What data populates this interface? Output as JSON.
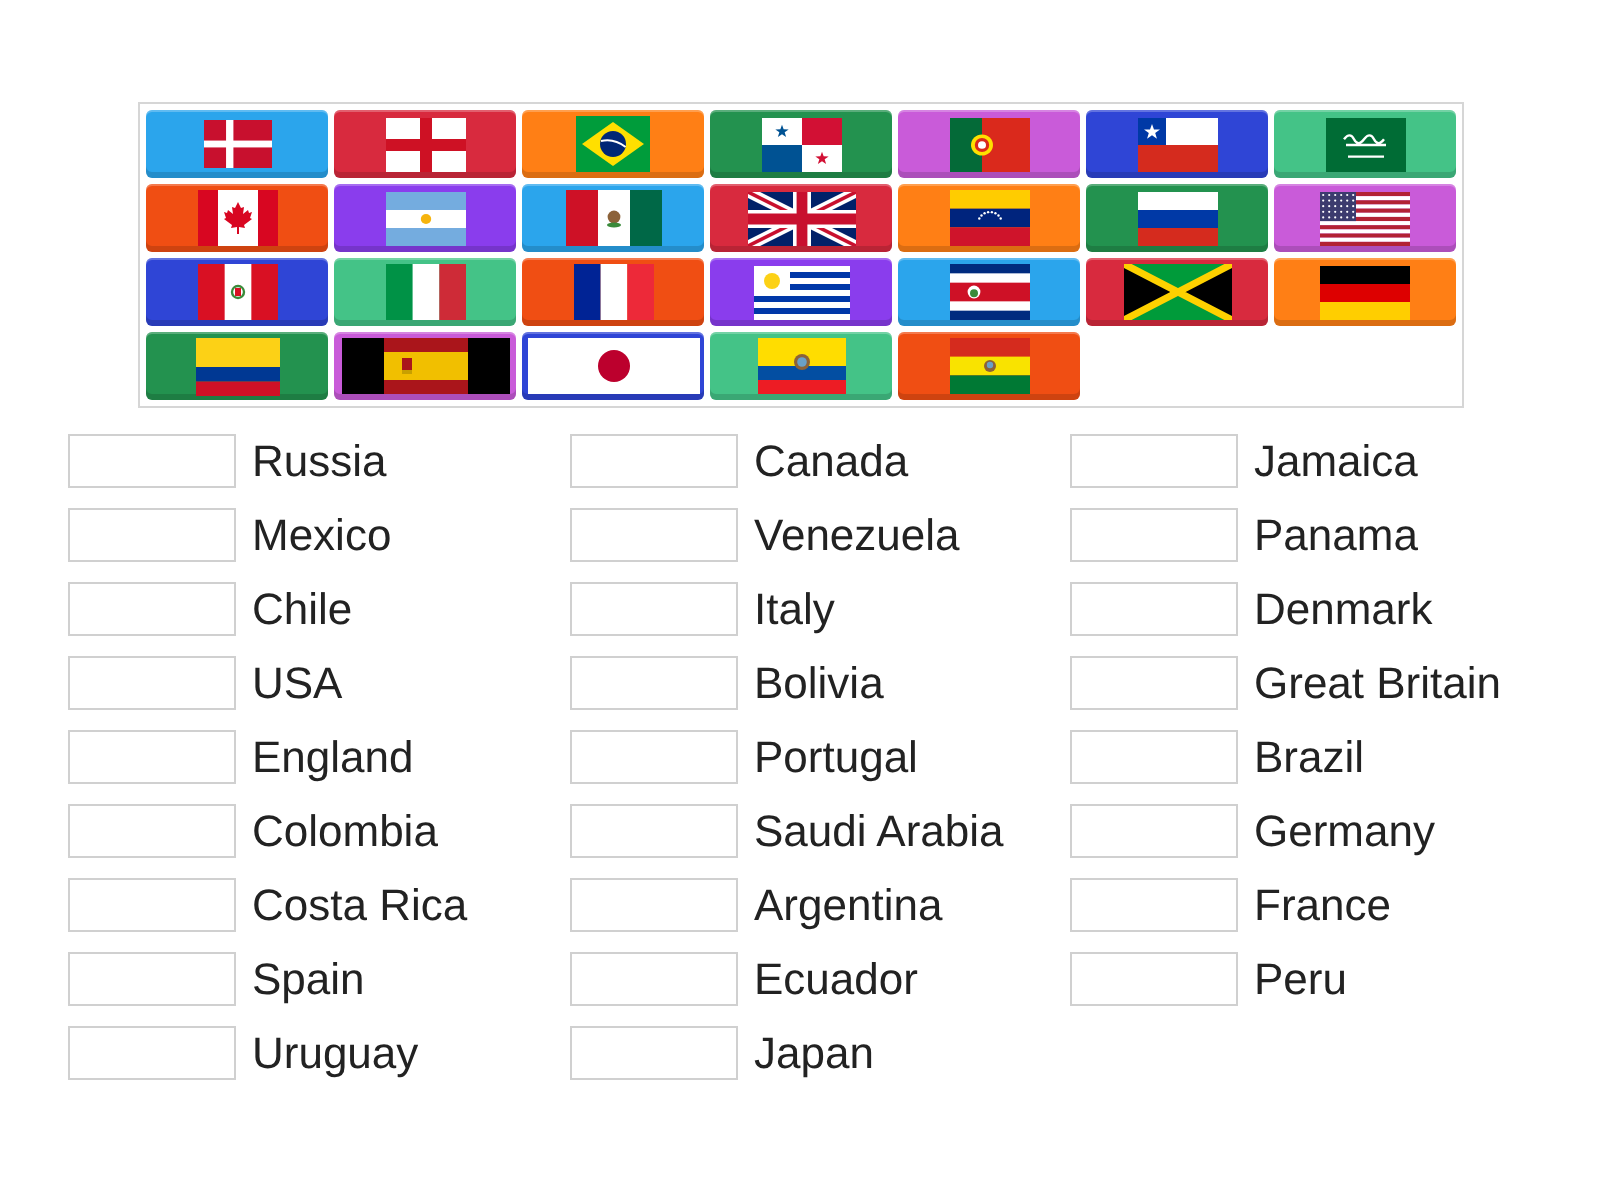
{
  "tiles": [
    {
      "kind": "denmark",
      "color": "#2ba5ec"
    },
    {
      "kind": "england",
      "color": "#d82a3e"
    },
    {
      "kind": "brazil",
      "color": "#ff7f15"
    },
    {
      "kind": "panama",
      "color": "#23924f"
    },
    {
      "kind": "portugal",
      "color": "#c95bd9"
    },
    {
      "kind": "chile",
      "color": "#2f45d6"
    },
    {
      "kind": "saudiarabia",
      "color": "#44c387"
    },
    {
      "kind": "canada",
      "color": "#f04e13"
    },
    {
      "kind": "argentina",
      "color": "#8a3ded"
    },
    {
      "kind": "mexico",
      "color": "#2ba5ec"
    },
    {
      "kind": "britain",
      "color": "#d82a3e"
    },
    {
      "kind": "venezuela",
      "color": "#ff7f15"
    },
    {
      "kind": "russia",
      "color": "#23924f"
    },
    {
      "kind": "usa",
      "color": "#c95bd9"
    },
    {
      "kind": "peru",
      "color": "#2f45d6"
    },
    {
      "kind": "italy",
      "color": "#44c387"
    },
    {
      "kind": "france",
      "color": "#f04e13"
    },
    {
      "kind": "uruguay",
      "color": "#8a3ded"
    },
    {
      "kind": "costarica",
      "color": "#2ba5ec"
    },
    {
      "kind": "jamaica",
      "color": "#d82a3e"
    },
    {
      "kind": "germany",
      "color": "#ff7f15"
    },
    {
      "kind": "colombia",
      "color": "#23924f"
    },
    {
      "kind": "spain",
      "color": "#c95bd9"
    },
    {
      "kind": "japan",
      "color": "#2f45d6"
    },
    {
      "kind": "ecuador",
      "color": "#44c387"
    },
    {
      "kind": "bolivia",
      "color": "#f04e13"
    }
  ],
  "answer_columns": [
    [
      "Russia",
      "Mexico",
      "Chile",
      "USA",
      "England",
      "Colombia",
      "Costa Rica",
      "Spain",
      "Uruguay"
    ],
    [
      "Canada",
      "Venezuela",
      "Italy",
      "Bolivia",
      "Portugal",
      "Saudi Arabia",
      "Argentina",
      "Ecuador",
      "Japan"
    ],
    [
      "Jamaica",
      "Panama",
      "Denmark",
      "Great Britain",
      "Brazil",
      "Germany",
      "France",
      "Peru"
    ]
  ]
}
